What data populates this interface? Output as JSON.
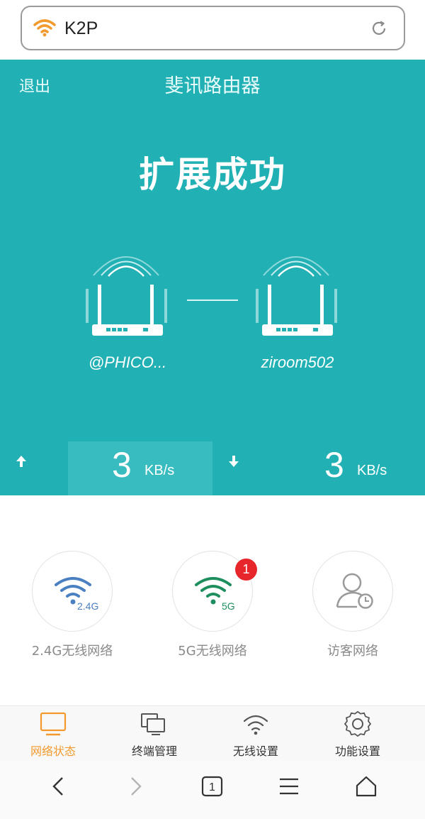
{
  "browser": {
    "url": "K2P",
    "tab_count": "1",
    "wifi_icon": "wifi-icon",
    "reload_icon": "reload-icon"
  },
  "header": {
    "exit_label": "退出",
    "title": "斐讯路由器"
  },
  "status": {
    "headline": "扩展成功",
    "upstream_router": "@PHICO...",
    "local_router": "ziroom502"
  },
  "speed": {
    "upload_value": "3",
    "upload_unit": "KB/s",
    "download_value": "3",
    "download_unit": "KB/s"
  },
  "networks": [
    {
      "label": "2.4G无线网络",
      "icon": "wifi-2.4g-icon",
      "icon_text": "2.4G",
      "color": "#4a7fc1"
    },
    {
      "label": "5G无线网络",
      "icon": "wifi-5g-icon",
      "icon_text": "5G",
      "color": "#1f8e5e",
      "badge": "1"
    },
    {
      "label": "访客网络",
      "icon": "guest-user-icon",
      "color": "#9a9a9a"
    }
  ],
  "tabs": [
    {
      "label": "网络状态",
      "icon": "monitor-icon",
      "active": true
    },
    {
      "label": "终端管理",
      "icon": "devices-icon"
    },
    {
      "label": "无线设置",
      "icon": "wifi-icon"
    },
    {
      "label": "功能设置",
      "icon": "gear-icon"
    }
  ],
  "colors": {
    "accent": "#21b1b5",
    "active_tab": "#f29a2e",
    "badge": "#e6262b"
  }
}
